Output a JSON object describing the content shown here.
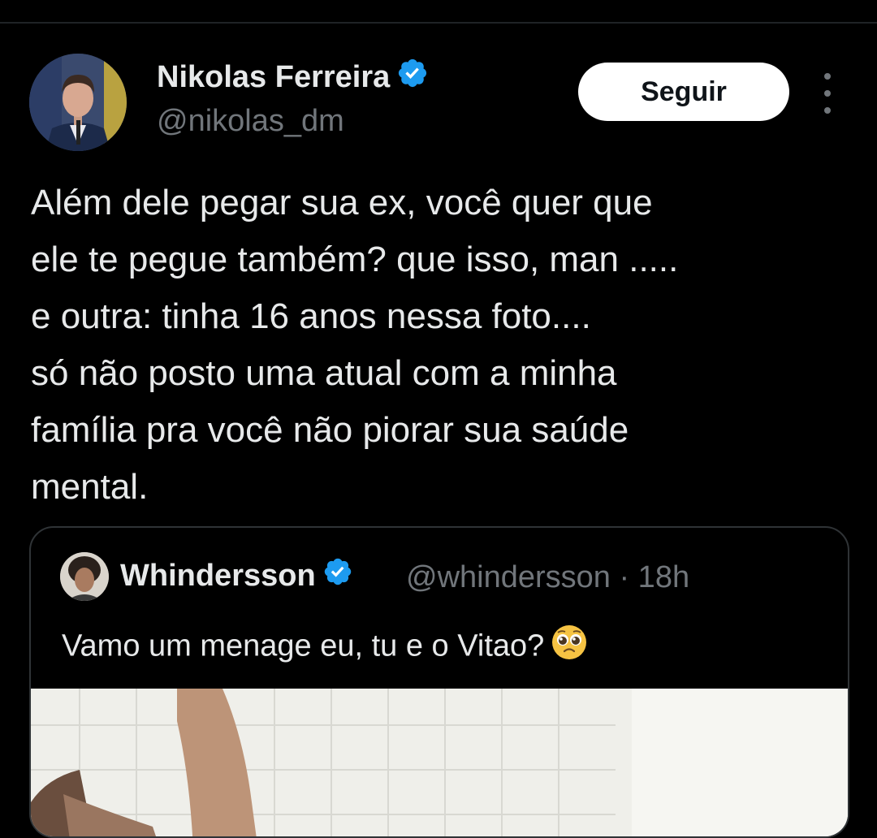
{
  "tweet": {
    "author": {
      "display_name": "Nikolas Ferreira",
      "handle": "@nikolas_dm",
      "verified_icon": "verified-badge-icon"
    },
    "follow_label": "Seguir",
    "more_icon": "more-vertical-icon",
    "text_lines": [
      "Além dele pegar sua ex, você quer que",
      "ele te pegue também? que isso, man .....",
      "e outra: tinha 16 anos nessa foto....",
      "só não posto uma atual com a minha",
      "família pra você não piorar sua saúde",
      "mental."
    ]
  },
  "quoted_tweet": {
    "display_name": "Whindersson",
    "handle_time": "@whindersson · 18h",
    "text": "Vamo um menage eu, tu e o Vitao?",
    "emoji_icon": "pleading-face-emoji"
  },
  "colors": {
    "background": "#000000",
    "text_primary": "#e7e9ea",
    "text_secondary": "#71767b",
    "verified_blue": "#1d9bf0",
    "border": "#2f3336",
    "button_bg": "#ffffff"
  }
}
